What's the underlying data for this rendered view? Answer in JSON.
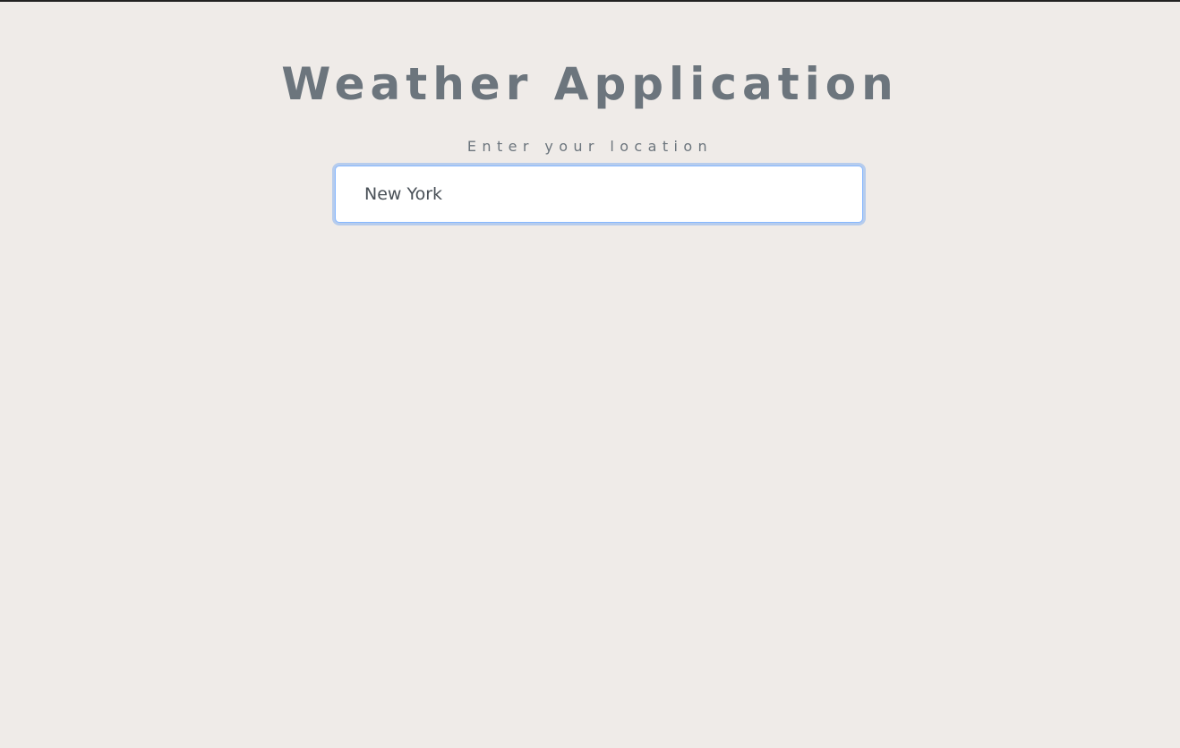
{
  "header": {
    "title": "Weather Application"
  },
  "search": {
    "label": "Enter your location",
    "value": "New York",
    "placeholder": ""
  },
  "colors": {
    "background": "#efebe8",
    "text": "#6c757d",
    "input_focus_border": "#86b7fe",
    "top_border": "#222222"
  }
}
